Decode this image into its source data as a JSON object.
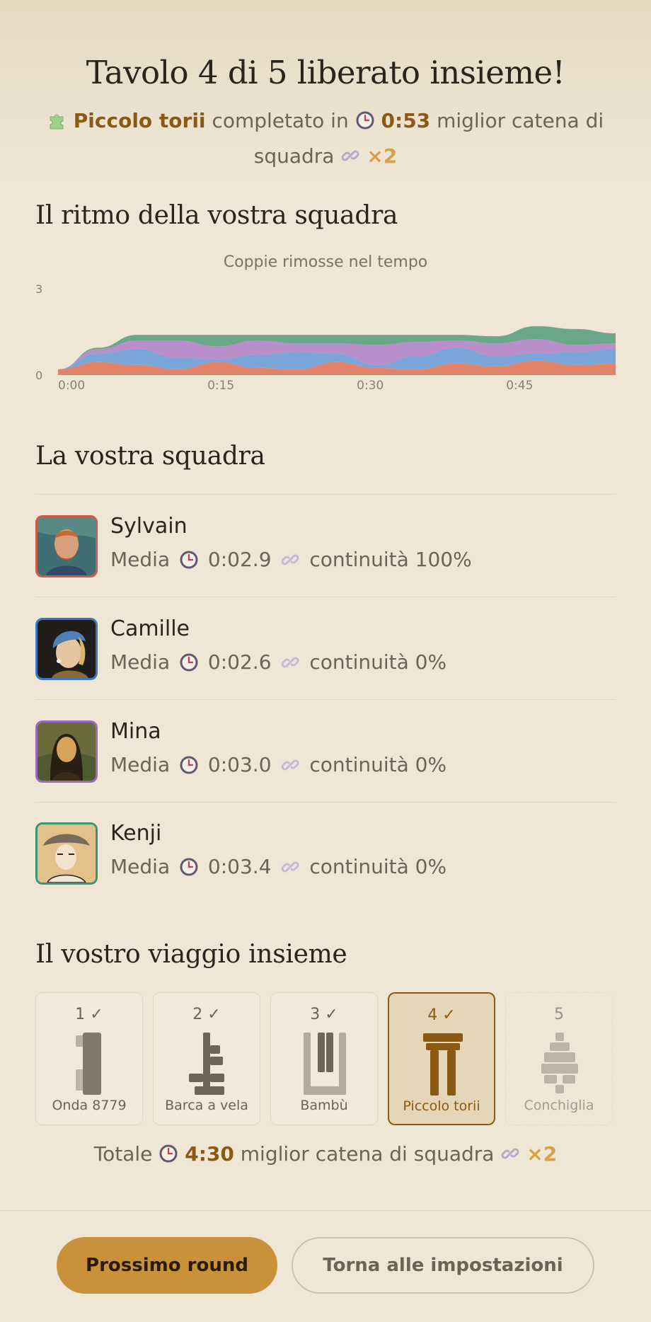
{
  "header": {
    "title": "Tavolo 4 di 5 liberato insieme!",
    "puzzle_name": "Piccolo torii",
    "completed_in_text": "completato in",
    "time": "0:53",
    "best_chain_text": "miglior catena di squadra",
    "chain_multiplier": "×2"
  },
  "rhythm_section": {
    "heading": "Il ritmo della vostra squadra"
  },
  "chart_data": {
    "type": "area",
    "title": "Coppie rimosse nel tempo",
    "xlabel": "",
    "ylabel": "",
    "x_ticks": [
      "0:00",
      "0:15",
      "0:30",
      "0:45"
    ],
    "y_ticks": [
      "0",
      "3"
    ],
    "x": [
      0,
      4,
      8,
      12,
      16,
      20,
      24,
      28,
      32,
      36,
      40,
      44,
      48,
      52,
      56
    ],
    "xlim": [
      0,
      56
    ],
    "ylim": [
      0,
      3
    ],
    "stacked": true,
    "series": [
      {
        "color": "#e07a5f",
        "values": [
          0.2,
          0.45,
          0.35,
          0.2,
          0.45,
          0.25,
          0.2,
          0.45,
          0.25,
          0.2,
          0.4,
          0.3,
          0.5,
          0.35,
          0.4
        ]
      },
      {
        "color": "#6f9fd8",
        "values": [
          0.0,
          0.3,
          0.55,
          0.4,
          0.1,
          0.45,
          0.6,
          0.3,
          0.1,
          0.45,
          0.55,
          0.35,
          0.25,
          0.45,
          0.5
        ]
      },
      {
        "color": "#b388c9",
        "values": [
          0.0,
          0.15,
          0.3,
          0.6,
          0.45,
          0.5,
          0.3,
          0.35,
          0.7,
          0.5,
          0.25,
          0.45,
          0.5,
          0.25,
          0.2
        ]
      },
      {
        "color": "#5fa383",
        "values": [
          0.0,
          0.05,
          0.2,
          0.2,
          0.4,
          0.2,
          0.3,
          0.3,
          0.35,
          0.25,
          0.2,
          0.25,
          0.45,
          0.55,
          0.35
        ]
      }
    ]
  },
  "team_section": {
    "heading": "La vostra squadra",
    "members": [
      {
        "name": "Sylvain",
        "avg_label": "Media",
        "avg_time": "0:02.9",
        "continuity": "continuità 100%",
        "color": "#d05a45",
        "portrait": "van-gogh"
      },
      {
        "name": "Camille",
        "avg_label": "Media",
        "avg_time": "0:02.6",
        "continuity": "continuità 0%",
        "color": "#3b77c2",
        "portrait": "pearl-earring"
      },
      {
        "name": "Mina",
        "avg_label": "Media",
        "avg_time": "0:03.0",
        "continuity": "continuità 0%",
        "color": "#9b6ac0",
        "portrait": "mona-lisa"
      },
      {
        "name": "Kenji",
        "avg_label": "Media",
        "avg_time": "0:03.4",
        "continuity": "continuità 0%",
        "color": "#3a9478",
        "portrait": "ukiyo-e"
      }
    ]
  },
  "journey_section": {
    "heading": "Il vostro viaggio insieme",
    "cards": [
      {
        "number": "1 ✓",
        "label": "Onda 8779",
        "state": "done"
      },
      {
        "number": "2 ✓",
        "label": "Barca a vela",
        "state": "done"
      },
      {
        "number": "3 ✓",
        "label": "Bambù",
        "state": "done"
      },
      {
        "number": "4 ✓",
        "label": "Piccolo torii",
        "state": "current"
      },
      {
        "number": "5",
        "label": "Conchiglia",
        "state": "upcoming"
      }
    ]
  },
  "totals": {
    "label": "Totale",
    "time": "4:30",
    "best_chain_text": "miglior catena di squadra",
    "chain_multiplier": "×2"
  },
  "actions": {
    "next_round": "Prossimo round",
    "back_to_settings": "Torna alle impostazioni"
  },
  "icons": {
    "puzzle": "puzzle-icon",
    "clock": "clock-icon",
    "link": "link-icon"
  },
  "colors": {
    "accent": "#c9923a",
    "highlight_text": "#8a5a14",
    "multiplier": "#d7a149",
    "background": "#efe5d5"
  }
}
